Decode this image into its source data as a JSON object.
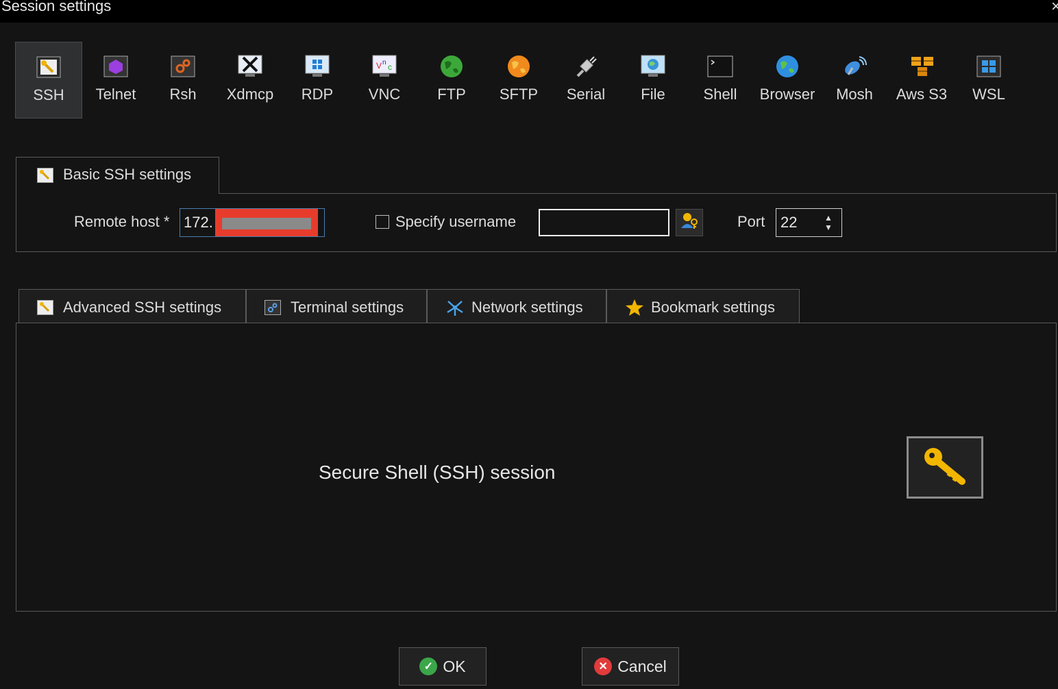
{
  "window": {
    "title": "Session settings",
    "close_glyph": "×"
  },
  "protocols": [
    {
      "label": "SSH",
      "icon": "ssh-key-icon",
      "active": true
    },
    {
      "label": "Telnet",
      "icon": "telnet-icon"
    },
    {
      "label": "Rsh",
      "icon": "rsh-icon"
    },
    {
      "label": "Xdmcp",
      "icon": "xdmcp-icon"
    },
    {
      "label": "RDP",
      "icon": "rdp-icon"
    },
    {
      "label": "VNC",
      "icon": "vnc-icon"
    },
    {
      "label": "FTP",
      "icon": "ftp-globe-icon"
    },
    {
      "label": "SFTP",
      "icon": "sftp-globe-icon"
    },
    {
      "label": "Serial",
      "icon": "serial-plug-icon"
    },
    {
      "label": "File",
      "icon": "file-monitor-icon"
    },
    {
      "label": "Shell",
      "icon": "shell-terminal-icon"
    },
    {
      "label": "Browser",
      "icon": "browser-globe-icon"
    },
    {
      "label": "Mosh",
      "icon": "mosh-satellite-icon"
    },
    {
      "label": "Aws S3",
      "icon": "aws-s3-cubes-icon"
    },
    {
      "label": "WSL",
      "icon": "wsl-windows-icon"
    }
  ],
  "basic": {
    "tab_label": "Basic SSH settings",
    "remote_host_label": "Remote host *",
    "remote_host_value": "172.",
    "specify_username_label": "Specify username",
    "specify_username_checked": false,
    "username_value": "",
    "port_label": "Port",
    "port_value": "22"
  },
  "tabs": [
    {
      "label": "Advanced SSH settings",
      "icon": "wrench-icon"
    },
    {
      "label": "Terminal settings",
      "icon": "terminal-gear-icon"
    },
    {
      "label": "Network settings",
      "icon": "network-star-icon"
    },
    {
      "label": "Bookmark settings",
      "icon": "star-icon"
    }
  ],
  "content": {
    "description": "Secure Shell (SSH) session"
  },
  "buttons": {
    "ok": "OK",
    "cancel": "Cancel"
  },
  "colors": {
    "background": "#141414",
    "border": "#5a5a5a",
    "redaction": "#e73c2c",
    "ok": "#3ba64a",
    "cancel": "#e23b3b"
  }
}
